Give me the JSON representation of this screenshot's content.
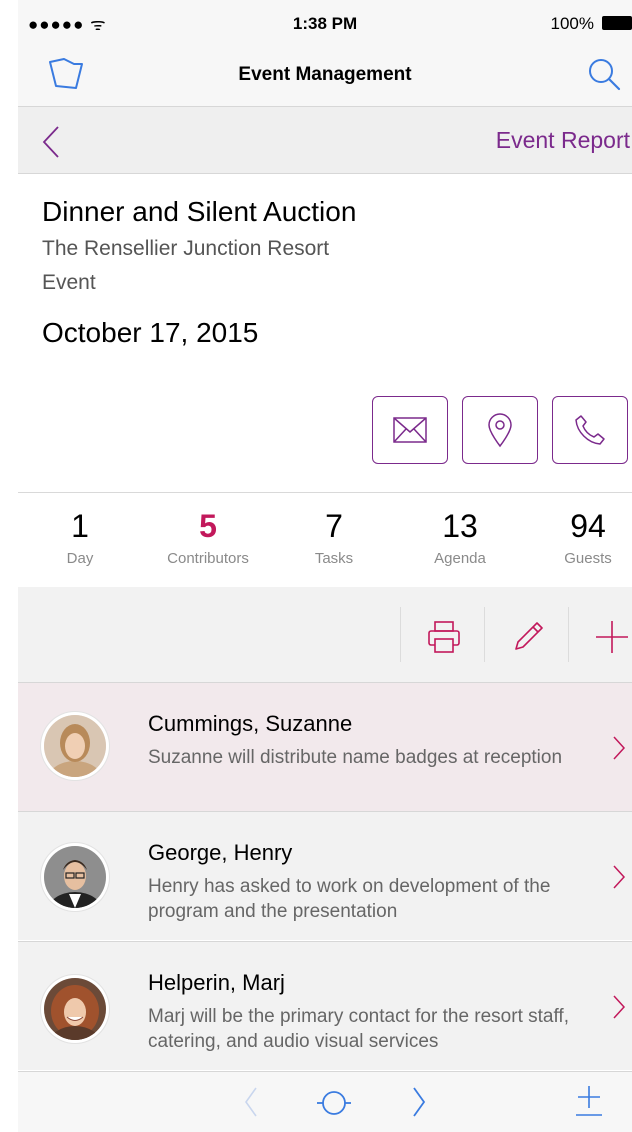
{
  "status": {
    "signal": "●●●●● ᯤ",
    "time": "1:38 PM",
    "battery": "100%"
  },
  "nav": {
    "title": "Event Management",
    "report_link": "Event Report"
  },
  "event": {
    "title": "Dinner and Silent Auction",
    "venue": "The Rensellier Junction Resort",
    "type": "Event",
    "date": "October 17, 2015"
  },
  "stats": [
    {
      "value": "1",
      "label": "Day"
    },
    {
      "value": "5",
      "label": "Contributors"
    },
    {
      "value": "7",
      "label": "Tasks"
    },
    {
      "value": "13",
      "label": "Agenda"
    },
    {
      "value": "94",
      "label": "Guests"
    }
  ],
  "contributors": [
    {
      "name": "Cummings, Suzanne",
      "desc": "Suzanne will distribute name badges at reception"
    },
    {
      "name": "George, Henry",
      "desc": "Henry has asked to work on development of the program and the presentation"
    },
    {
      "name": "Helperin, Marj",
      "desc": "Marj will be the primary contact for the resort staff, catering, and audio visual services"
    }
  ],
  "colors": {
    "accent": "#7b2a8c",
    "highlight": "#c2185b",
    "ios_blue": "#3a7be0",
    "selected_row": "#f2e9ec"
  },
  "icons": [
    "folder-icon",
    "search-icon",
    "back-chevron-icon",
    "mail-icon",
    "location-pin-icon",
    "phone-icon",
    "print-icon",
    "edit-pencil-icon",
    "add-icon",
    "row-chevron-icon",
    "prev-icon",
    "home-circle-icon",
    "next-icon",
    "plus-minus-icon"
  ]
}
